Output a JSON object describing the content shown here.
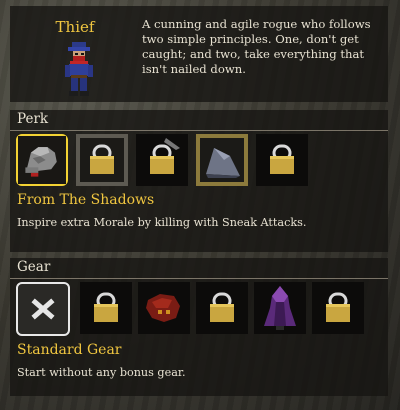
{
  "class": {
    "name": "Thief",
    "description": "A cunning and agile rogue who follows two simple principles. One, don't get caught; and two, take everything that isn't nailed down.",
    "sprite_icon": "thief-character-icon"
  },
  "perk": {
    "section_label": "Perk",
    "slots": [
      {
        "icon": "gauntlet-icon",
        "state": "selected"
      },
      {
        "icon": "lock-icon",
        "state": "locked"
      },
      {
        "icon": "lock-icon",
        "state": "locked"
      },
      {
        "icon": "shark-fin-icon",
        "state": "available"
      },
      {
        "icon": "lock-icon",
        "state": "locked"
      }
    ],
    "selected_name": "From The Shadows",
    "selected_description": "Inspire extra Morale by killing with Sneak Attacks."
  },
  "gear": {
    "section_label": "Gear",
    "slots": [
      {
        "icon": "none-x-icon",
        "state": "selected"
      },
      {
        "icon": "lock-icon",
        "state": "locked"
      },
      {
        "icon": "red-beast-icon",
        "state": "available"
      },
      {
        "icon": "lock-icon",
        "state": "locked"
      },
      {
        "icon": "purple-cloak-icon",
        "state": "available"
      },
      {
        "icon": "lock-icon",
        "state": "locked"
      }
    ],
    "selected_name": "Standard Gear",
    "selected_description": "Start without any bonus gear."
  },
  "colors": {
    "accent_gold": "#f0c640",
    "selected_perk_border": "#f3d233",
    "selected_gear_border": "#e8e8e8",
    "text": "#e8e2d2"
  }
}
